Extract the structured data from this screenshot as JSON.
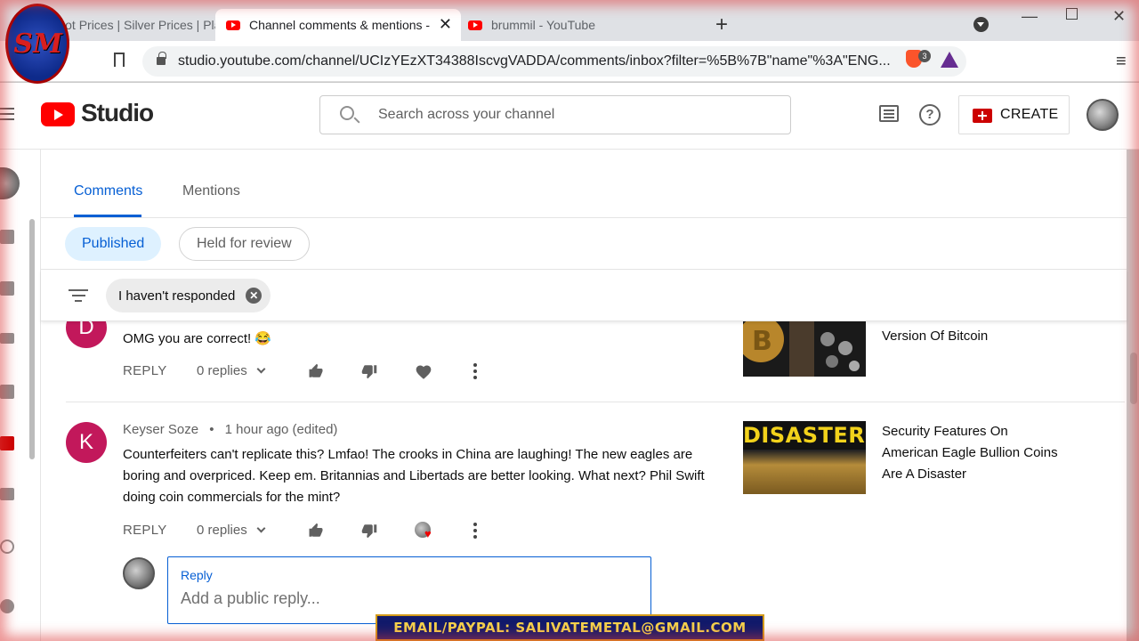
{
  "browser": {
    "tabs": [
      {
        "title": "Spot Prices | Silver Prices | Platinum"
      },
      {
        "title": "Channel comments & mentions - "
      },
      {
        "title": "brummil - YouTube"
      }
    ],
    "url": "studio.youtube.com/channel/UCIzYEzXT34388IscvgVADDA/comments/inbox?filter=%5B%7B\"name\"%3A\"ENG...",
    "extension_badge": "3"
  },
  "header": {
    "studio_label": "Studio",
    "search_placeholder": "Search across your channel",
    "create_label": "CREATE"
  },
  "tabs": {
    "comments": "Comments",
    "mentions": "Mentions"
  },
  "chips": {
    "published": "Published",
    "held": "Held for review"
  },
  "filter": {
    "label": "I haven't responded"
  },
  "comments": [
    {
      "avatar_letter": "D",
      "avatar_color": "#c2185b",
      "text": "OMG you are correct! 😂",
      "reply_label": "REPLY",
      "replies": "0 replies",
      "video_title": "Version Of Bitcoin"
    },
    {
      "avatar_letter": "K",
      "avatar_color": "#c2185b",
      "author": "Keyser Soze",
      "time": "1 hour ago (edited)",
      "text": "Counterfeiters can't replicate this? Lmfao! The crooks in China are laughing!  The new eagles are boring and overpriced. Keep em. Britannias and Libertads are better looking. What next? Phil Swift doing coin commercials for the mint?",
      "reply_label": "REPLY",
      "replies": "0 replies",
      "video_title": "Security Features On American Eagle Bullion Coins Are A Disaster",
      "thumb_text": "DISASTER!"
    }
  ],
  "reply_box": {
    "label": "Reply",
    "placeholder": "Add a public reply..."
  },
  "overlay": {
    "logo_text": "SM",
    "banner": "EMAIL/PAYPAL: SALIVATEMETAL@GMAIL.COM"
  },
  "colors": {
    "accent": "#065fd4",
    "brand_red": "#ff0000",
    "chip_bg": "#def1ff"
  }
}
